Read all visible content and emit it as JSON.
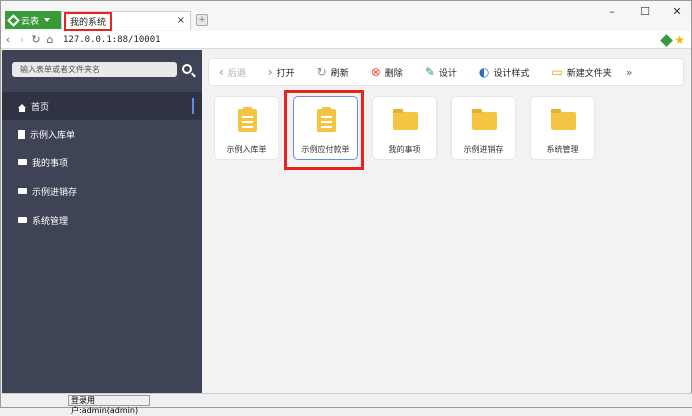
{
  "browser": {
    "app_tab_label": "云表",
    "page_tab_label": "我的系统",
    "close_tab_glyph": "×",
    "new_tab_glyph": "+",
    "url": "127.0.0.1:88/10001",
    "window_controls": {
      "minimize": "–",
      "maximize": "☐",
      "close": "✕"
    }
  },
  "sidebar": {
    "search_placeholder": "输入表单或者文件夹名",
    "items": [
      {
        "label": "首页",
        "icon": "home-icon",
        "active": true
      },
      {
        "label": "示例入库单",
        "icon": "document-icon"
      },
      {
        "label": "我的事项",
        "icon": "folder-icon"
      },
      {
        "label": "示例进销存",
        "icon": "folder-icon"
      },
      {
        "label": "系统管理",
        "icon": "folder-icon"
      }
    ]
  },
  "toolbar": {
    "back": "后退",
    "open": "打开",
    "refresh": "刷新",
    "delete": "删除",
    "design": "设计",
    "design_style": "设计样式",
    "new_folder": "新建文件夹",
    "more": "»"
  },
  "tiles": [
    {
      "label": "示例入库单",
      "icon": "clipboard-icon"
    },
    {
      "label": "示例应付款单",
      "icon": "clipboard-icon",
      "selected": true
    },
    {
      "label": "我的事项",
      "icon": "folder-icon"
    },
    {
      "label": "示例进销存",
      "icon": "folder-icon"
    },
    {
      "label": "系统管理",
      "icon": "folder-icon"
    }
  ],
  "status": {
    "user": "登录用户:admin(admin)"
  },
  "colors": {
    "sidebar_bg": "#3e4355",
    "accent_green": "#3a9a3a",
    "highlight_red": "#e8231f",
    "folder_yellow": "#f4c542"
  }
}
